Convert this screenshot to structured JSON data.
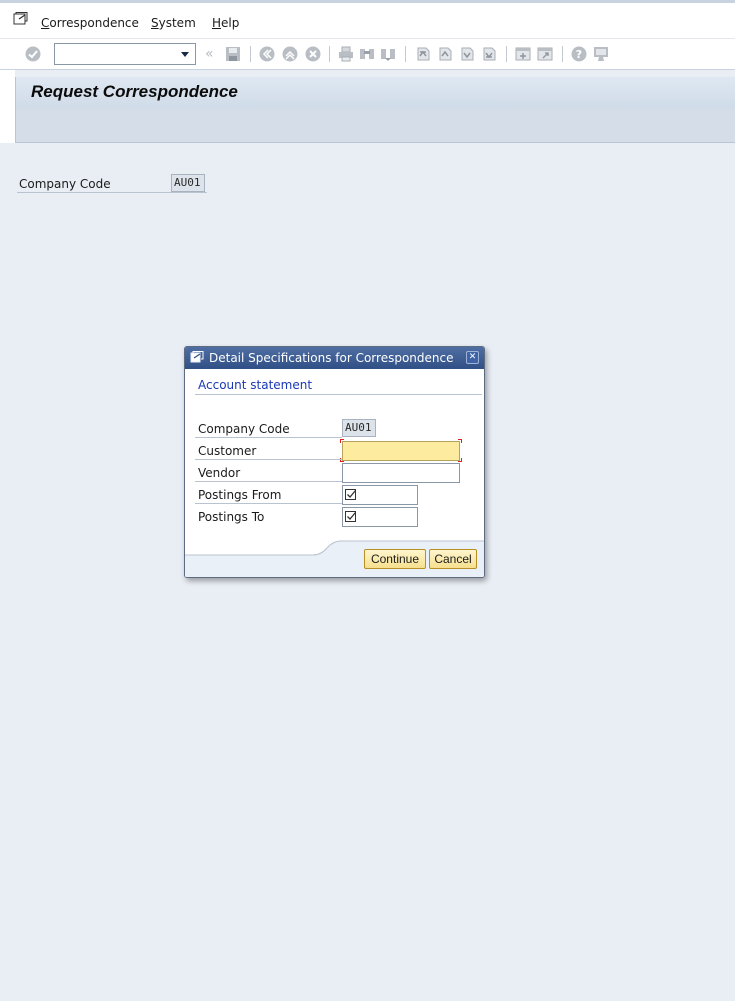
{
  "menubar": {
    "items": [
      {
        "label_ul": "C",
        "label_rest": "orrespondence"
      },
      {
        "label_ul": "S",
        "label_rest": "ystem"
      },
      {
        "label_ul": "H",
        "label_rest": "elp"
      }
    ]
  },
  "toolbar": {
    "command_field_value": "",
    "icons": [
      "enter-icon",
      "save-icon",
      "back-icon",
      "exit-icon",
      "cancel-icon",
      "print-icon",
      "find-icon",
      "find-next-icon",
      "first-page-icon",
      "previous-page-icon",
      "next-page-icon",
      "last-page-icon",
      "create-session-icon",
      "shortcut-icon",
      "help-icon",
      "customize-layout-icon"
    ]
  },
  "page": {
    "title": "Request Correspondence"
  },
  "main": {
    "company_code_label": "Company Code",
    "company_code_value": "AU01"
  },
  "dialog": {
    "title": "Detail Specifications for Correspondence",
    "group_title": "Account statement",
    "fields": {
      "company_code": {
        "label": "Company Code",
        "value": "AU01"
      },
      "customer": {
        "label": "Customer",
        "value": ""
      },
      "vendor": {
        "label": "Vendor",
        "value": ""
      },
      "postings_from": {
        "label": "Postings From",
        "value": ""
      },
      "postings_to": {
        "label": "Postings To",
        "value": ""
      }
    },
    "buttons": {
      "continue": "Continue",
      "cancel": "Cancel"
    }
  },
  "colors": {
    "accent": "#2f4f86",
    "group_title": "#1a38b5",
    "required_field": "#fdeba0",
    "button": "#f6df8d"
  }
}
